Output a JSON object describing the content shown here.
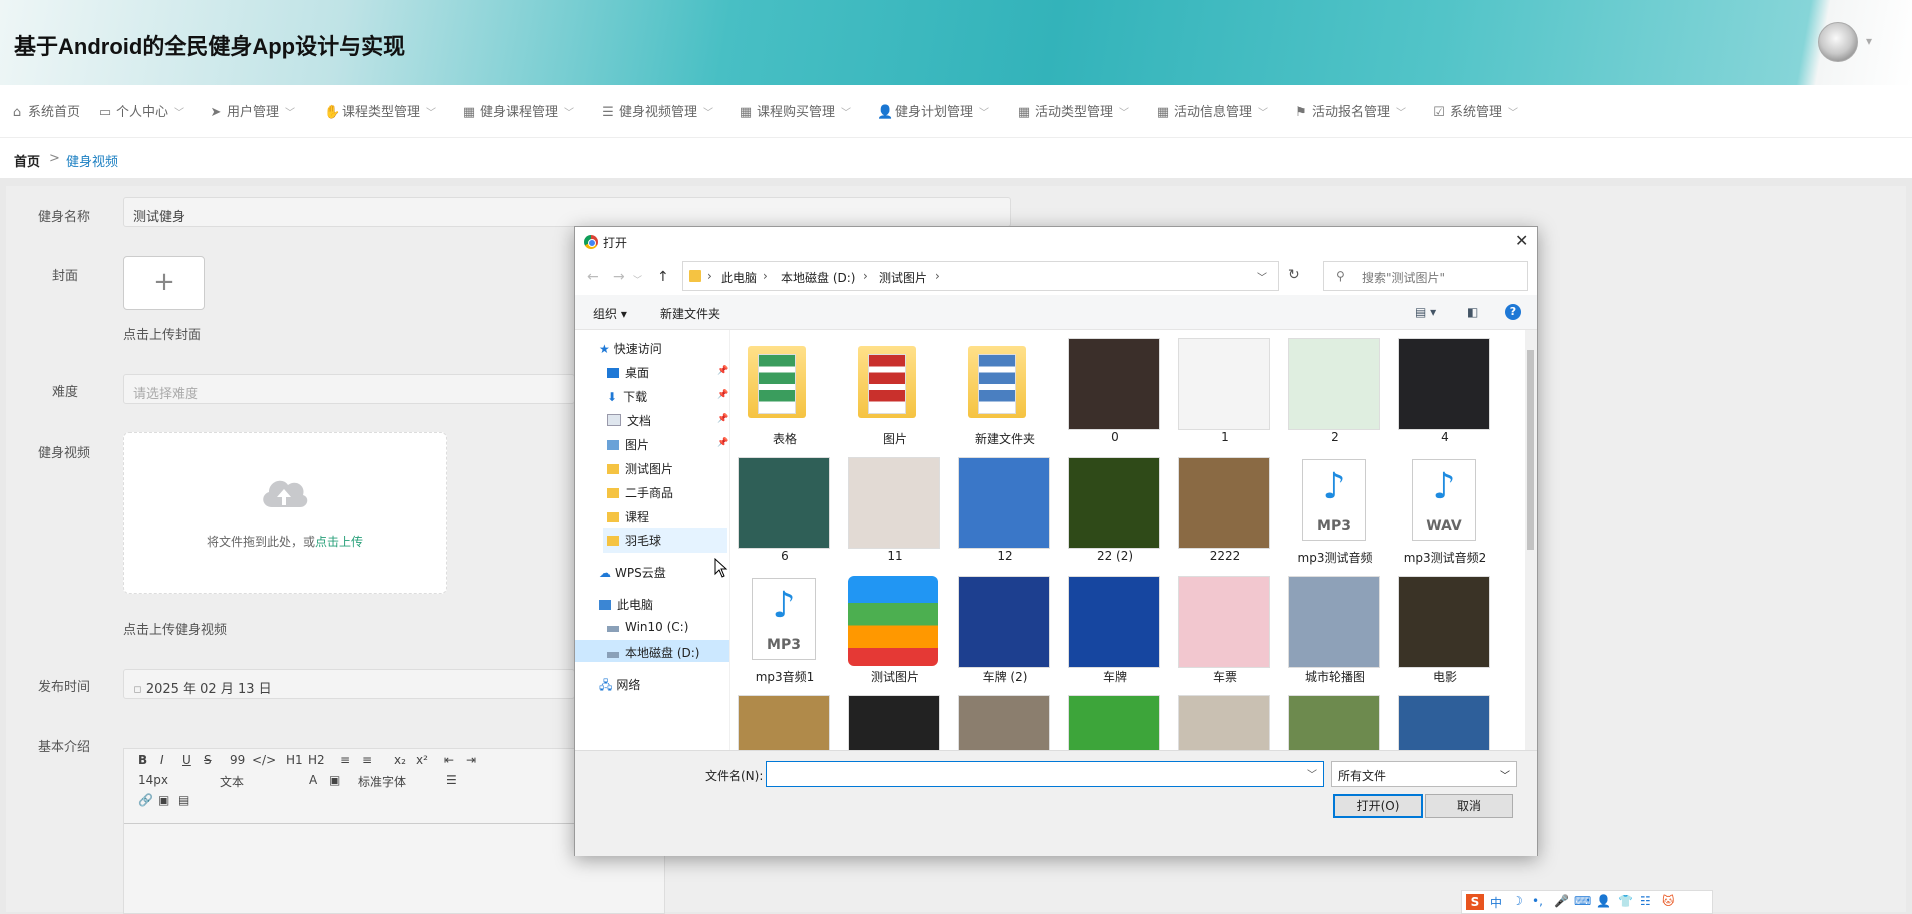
{
  "app": {
    "title": "基于Android的全民健身App设计与实现"
  },
  "nav": {
    "items": [
      {
        "label": "系统首页",
        "icon": "home-icon"
      },
      {
        "label": "个人中心",
        "icon": "id-card-icon"
      },
      {
        "label": "用户管理",
        "icon": "send-icon"
      },
      {
        "label": "课程类型管理",
        "icon": "thumb-icon"
      },
      {
        "label": "健身课程管理",
        "icon": "grid-icon"
      },
      {
        "label": "健身视频管理",
        "icon": "list-icon"
      },
      {
        "label": "课程购买管理",
        "icon": "grid-icon"
      },
      {
        "label": "健身计划管理",
        "icon": "user-icon"
      },
      {
        "label": "活动类型管理",
        "icon": "grid-icon"
      },
      {
        "label": "活动信息管理",
        "icon": "grid-icon"
      },
      {
        "label": "活动报名管理",
        "icon": "flag-icon"
      },
      {
        "label": "系统管理",
        "icon": "check-square-icon"
      }
    ]
  },
  "breadcrumb": {
    "home": "首页",
    "sep": ">",
    "current": "健身视频"
  },
  "form": {
    "name_label": "健身名称",
    "name_value": "测试健身",
    "cover_label": "封面",
    "cover_plus": "+",
    "cover_hint": "点击上传封面",
    "difficulty_label": "难度",
    "difficulty_placeholder": "请选择难度",
    "video_label": "健身视频",
    "drag_text": "将文件拖到此处，或",
    "drag_link": "点击上传",
    "video_hint": "点击上传健身视频",
    "date_label": "发布时间",
    "date_value": "2025 年 02 月 13 日",
    "intro_label": "基本介绍",
    "editor": {
      "row1": [
        "B",
        "I",
        "U",
        "S",
        "99",
        "</>",
        "H1",
        "H2",
        "≡",
        "≡",
        "x₂",
        "x²",
        "⇤",
        "⇥"
      ],
      "size": "14px",
      "format": "文本",
      "font": "标准字体"
    }
  },
  "dialog": {
    "title": "打开",
    "path": [
      "此电脑",
      "本地磁盘 (D:)",
      "测试图片"
    ],
    "search_placeholder": "搜索\"测试图片\"",
    "organize": "组织 ▾",
    "new_folder": "新建文件夹",
    "tree": [
      {
        "label": "快速访问",
        "icon": "star-icon"
      },
      {
        "label": "桌面",
        "icon": "desktop-icon",
        "pinned": true
      },
      {
        "label": "下载",
        "icon": "download-icon",
        "pinned": true
      },
      {
        "label": "文档",
        "icon": "document-icon",
        "pinned": true
      },
      {
        "label": "图片",
        "icon": "picture-icon",
        "pinned": true
      },
      {
        "label": "测试图片",
        "icon": "folder-icon"
      },
      {
        "label": "二手商品",
        "icon": "folder-icon"
      },
      {
        "label": "课程",
        "icon": "folder-icon"
      },
      {
        "label": "羽毛球",
        "icon": "folder-icon"
      },
      {
        "label": "WPS云盘",
        "icon": "cloud-icon"
      },
      {
        "label": "此电脑",
        "icon": "computer-icon"
      },
      {
        "label": "Win10 (C:)",
        "icon": "drive-icon"
      },
      {
        "label": "本地磁盘 (D:)",
        "icon": "drive-icon"
      },
      {
        "label": "网络",
        "icon": "network-icon"
      }
    ],
    "files": [
      {
        "name": "表格",
        "kind": "folder",
        "color": "#3a9d5d"
      },
      {
        "name": "图片",
        "kind": "folder",
        "color": "#c9302c"
      },
      {
        "name": "新建文件夹",
        "kind": "folder",
        "color": "#4a7fc1"
      },
      {
        "name": "0",
        "kind": "image",
        "color": "#3b2f2a"
      },
      {
        "name": "1",
        "kind": "image",
        "color": "#f4f4f4"
      },
      {
        "name": "2",
        "kind": "image",
        "color": "#dfeee0"
      },
      {
        "name": "4",
        "kind": "image",
        "color": "#232326"
      },
      {
        "name": "6",
        "kind": "image",
        "color": "#2f5f57"
      },
      {
        "name": "11",
        "kind": "image",
        "color": "#e2dad4"
      },
      {
        "name": "12",
        "kind": "image",
        "color": "#3a77c8"
      },
      {
        "name": "22 (2)",
        "kind": "image",
        "color": "#2f4a18"
      },
      {
        "name": "2222",
        "kind": "image",
        "color": "#8a6a44"
      },
      {
        "name": "mp3测试音频",
        "kind": "audio",
        "ext": "MP3"
      },
      {
        "name": "mp3测试音频2",
        "kind": "audio",
        "ext": "WAV"
      },
      {
        "name": "mp3音频1",
        "kind": "audio",
        "ext": "MP3"
      },
      {
        "name": "测试图片",
        "kind": "archive",
        "color": "#1e88e5"
      },
      {
        "name": "车牌 (2)",
        "kind": "image",
        "color": "#1d3f8f"
      },
      {
        "name": "车牌",
        "kind": "image",
        "color": "#1646a0"
      },
      {
        "name": "车票",
        "kind": "image",
        "color": "#f2c7cf"
      },
      {
        "name": "城市轮播图",
        "kind": "image",
        "color": "#8ea1b8"
      },
      {
        "name": "电影",
        "kind": "image",
        "color": "#3a3326"
      },
      {
        "name": "",
        "kind": "image",
        "color": "#b08a4a"
      },
      {
        "name": "",
        "kind": "image",
        "color": "#222222"
      },
      {
        "name": "",
        "kind": "image",
        "color": "#8b7e6e"
      },
      {
        "name": "",
        "kind": "image",
        "color": "#3da53a"
      },
      {
        "name": "",
        "kind": "image",
        "color": "#c9c0b2"
      },
      {
        "name": "",
        "kind": "image",
        "color": "#6d8a4e"
      },
      {
        "name": "",
        "kind": "image",
        "color": "#2e5f9a"
      }
    ],
    "filename_label": "文件名(N):",
    "filename_value": "",
    "filetype": "所有文件",
    "open_label": "打开(O)",
    "cancel_label": "取消"
  },
  "ime": {
    "items": [
      "S",
      "中",
      "☽",
      "•,",
      "🎤",
      "⌨",
      "👤",
      "👕",
      "☷",
      "🐱"
    ]
  },
  "colors": {
    "accent": "#29a07a",
    "link": "#1b7fc2",
    "primary_btn_border": "#0078d7"
  }
}
